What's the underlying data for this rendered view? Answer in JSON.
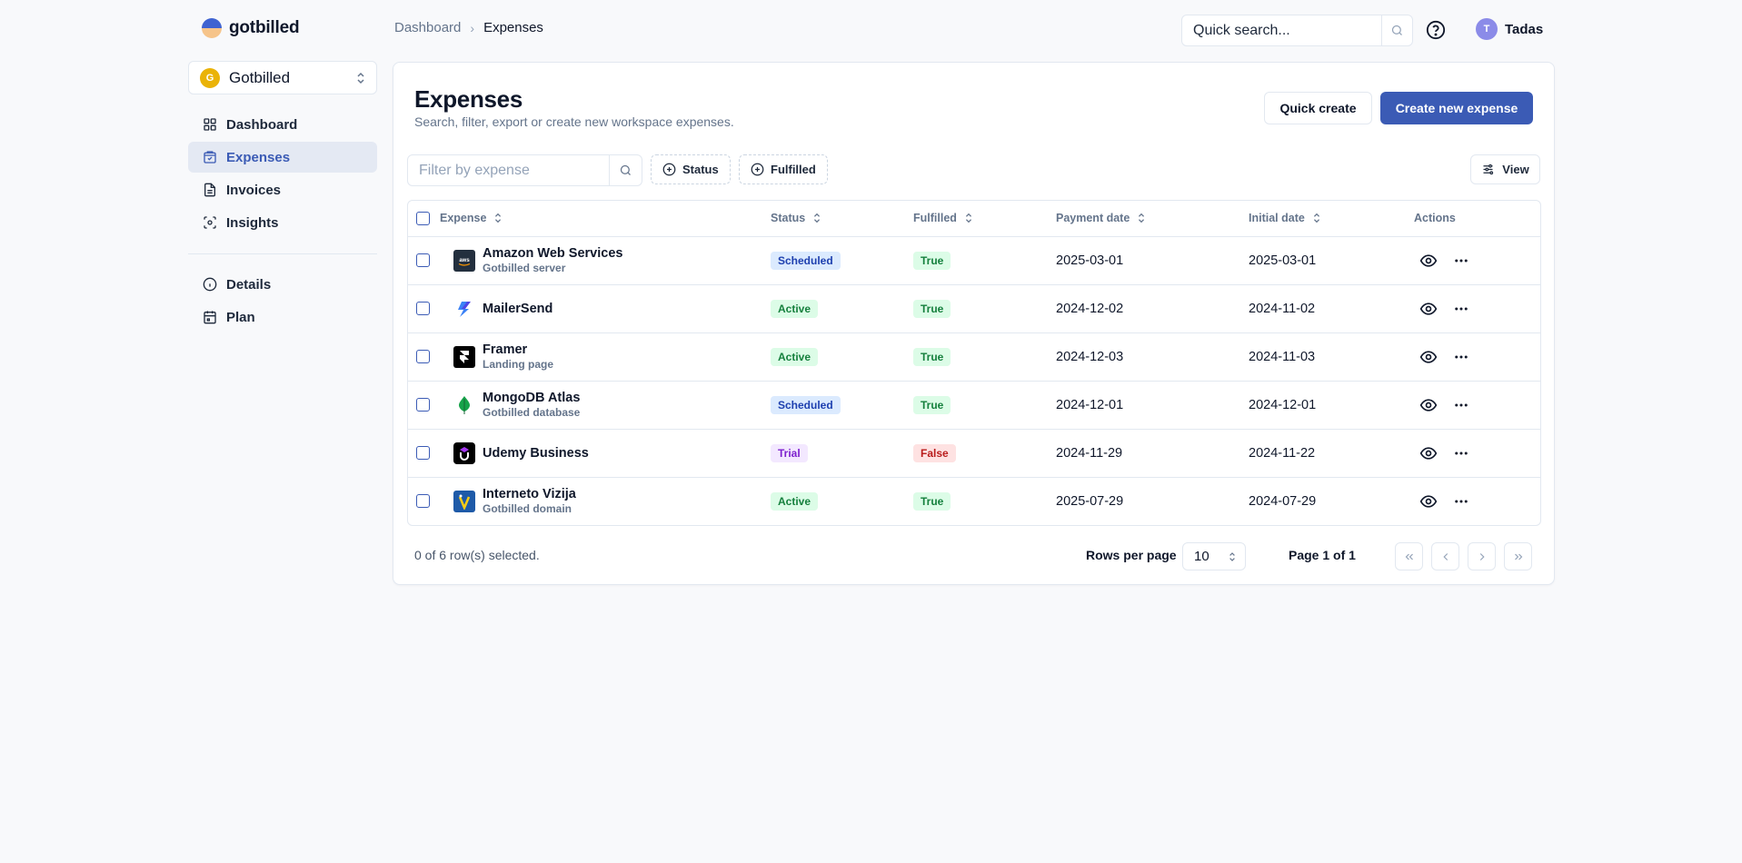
{
  "app": {
    "name": "gotbilled"
  },
  "breadcrumb": {
    "parent": "Dashboard",
    "separator": "›",
    "current": "Expenses"
  },
  "header": {
    "search_placeholder": "Quick search...",
    "user_initial": "T",
    "user_name": "Tadas"
  },
  "workspace": {
    "initial": "G",
    "name": "Gotbilled"
  },
  "sidebar": {
    "main": [
      {
        "label": "Dashboard",
        "icon": "dashboard-icon"
      },
      {
        "label": "Expenses",
        "icon": "wallet-icon",
        "active": true
      },
      {
        "label": "Invoices",
        "icon": "document-icon"
      },
      {
        "label": "Insights",
        "icon": "insights-icon"
      }
    ],
    "secondary": [
      {
        "label": "Details",
        "icon": "info-icon"
      },
      {
        "label": "Plan",
        "icon": "calendar-icon"
      }
    ]
  },
  "page": {
    "title": "Expenses",
    "subtitle": "Search, filter, export or create new workspace expenses.",
    "quick_create_label": "Quick create",
    "create_label": "Create new expense"
  },
  "filters": {
    "placeholder": "Filter by expense",
    "status_label": "Status",
    "fulfilled_label": "Fulfilled",
    "view_label": "View"
  },
  "table": {
    "columns": [
      "Expense",
      "Status",
      "Fulfilled",
      "Payment date",
      "Initial date",
      "Actions"
    ],
    "rows": [
      {
        "name": "Amazon Web Services",
        "desc": "Gotbilled server",
        "logo": "aws-logo-icon",
        "status": "Scheduled",
        "fulfilled": "True",
        "payment_date": "2025-03-01",
        "initial_date": "2025-03-01"
      },
      {
        "name": "MailerSend",
        "desc": "",
        "logo": "mailersend-logo-icon",
        "status": "Active",
        "fulfilled": "True",
        "payment_date": "2024-12-02",
        "initial_date": "2024-11-02"
      },
      {
        "name": "Framer",
        "desc": "Landing page",
        "logo": "framer-logo-icon",
        "status": "Active",
        "fulfilled": "True",
        "payment_date": "2024-12-03",
        "initial_date": "2024-11-03"
      },
      {
        "name": "MongoDB Atlas",
        "desc": "Gotbilled database",
        "logo": "mongodb-logo-icon",
        "status": "Scheduled",
        "fulfilled": "True",
        "payment_date": "2024-12-01",
        "initial_date": "2024-12-01"
      },
      {
        "name": "Udemy Business",
        "desc": "",
        "logo": "udemy-logo-icon",
        "status": "Trial",
        "fulfilled": "False",
        "payment_date": "2024-11-29",
        "initial_date": "2024-11-22"
      },
      {
        "name": "Interneto Vizija",
        "desc": "Gotbilled domain",
        "logo": "interneto-vizija-logo-icon",
        "status": "Active",
        "fulfilled": "True",
        "payment_date": "2025-07-29",
        "initial_date": "2024-07-29"
      }
    ]
  },
  "footer": {
    "selected_text": "0 of 6 row(s) selected.",
    "rows_per_page_label": "Rows per page",
    "rows_per_page_value": "10",
    "page_info": "Page 1 of 1"
  },
  "colors": {
    "brand": "#3b5bb5",
    "active_nav_bg": "#e4e9f3",
    "badge_scheduled": "#dbeafe",
    "badge_active": "#dcfce7",
    "badge_trial": "#f3e8ff",
    "badge_false": "#fee2e2"
  }
}
